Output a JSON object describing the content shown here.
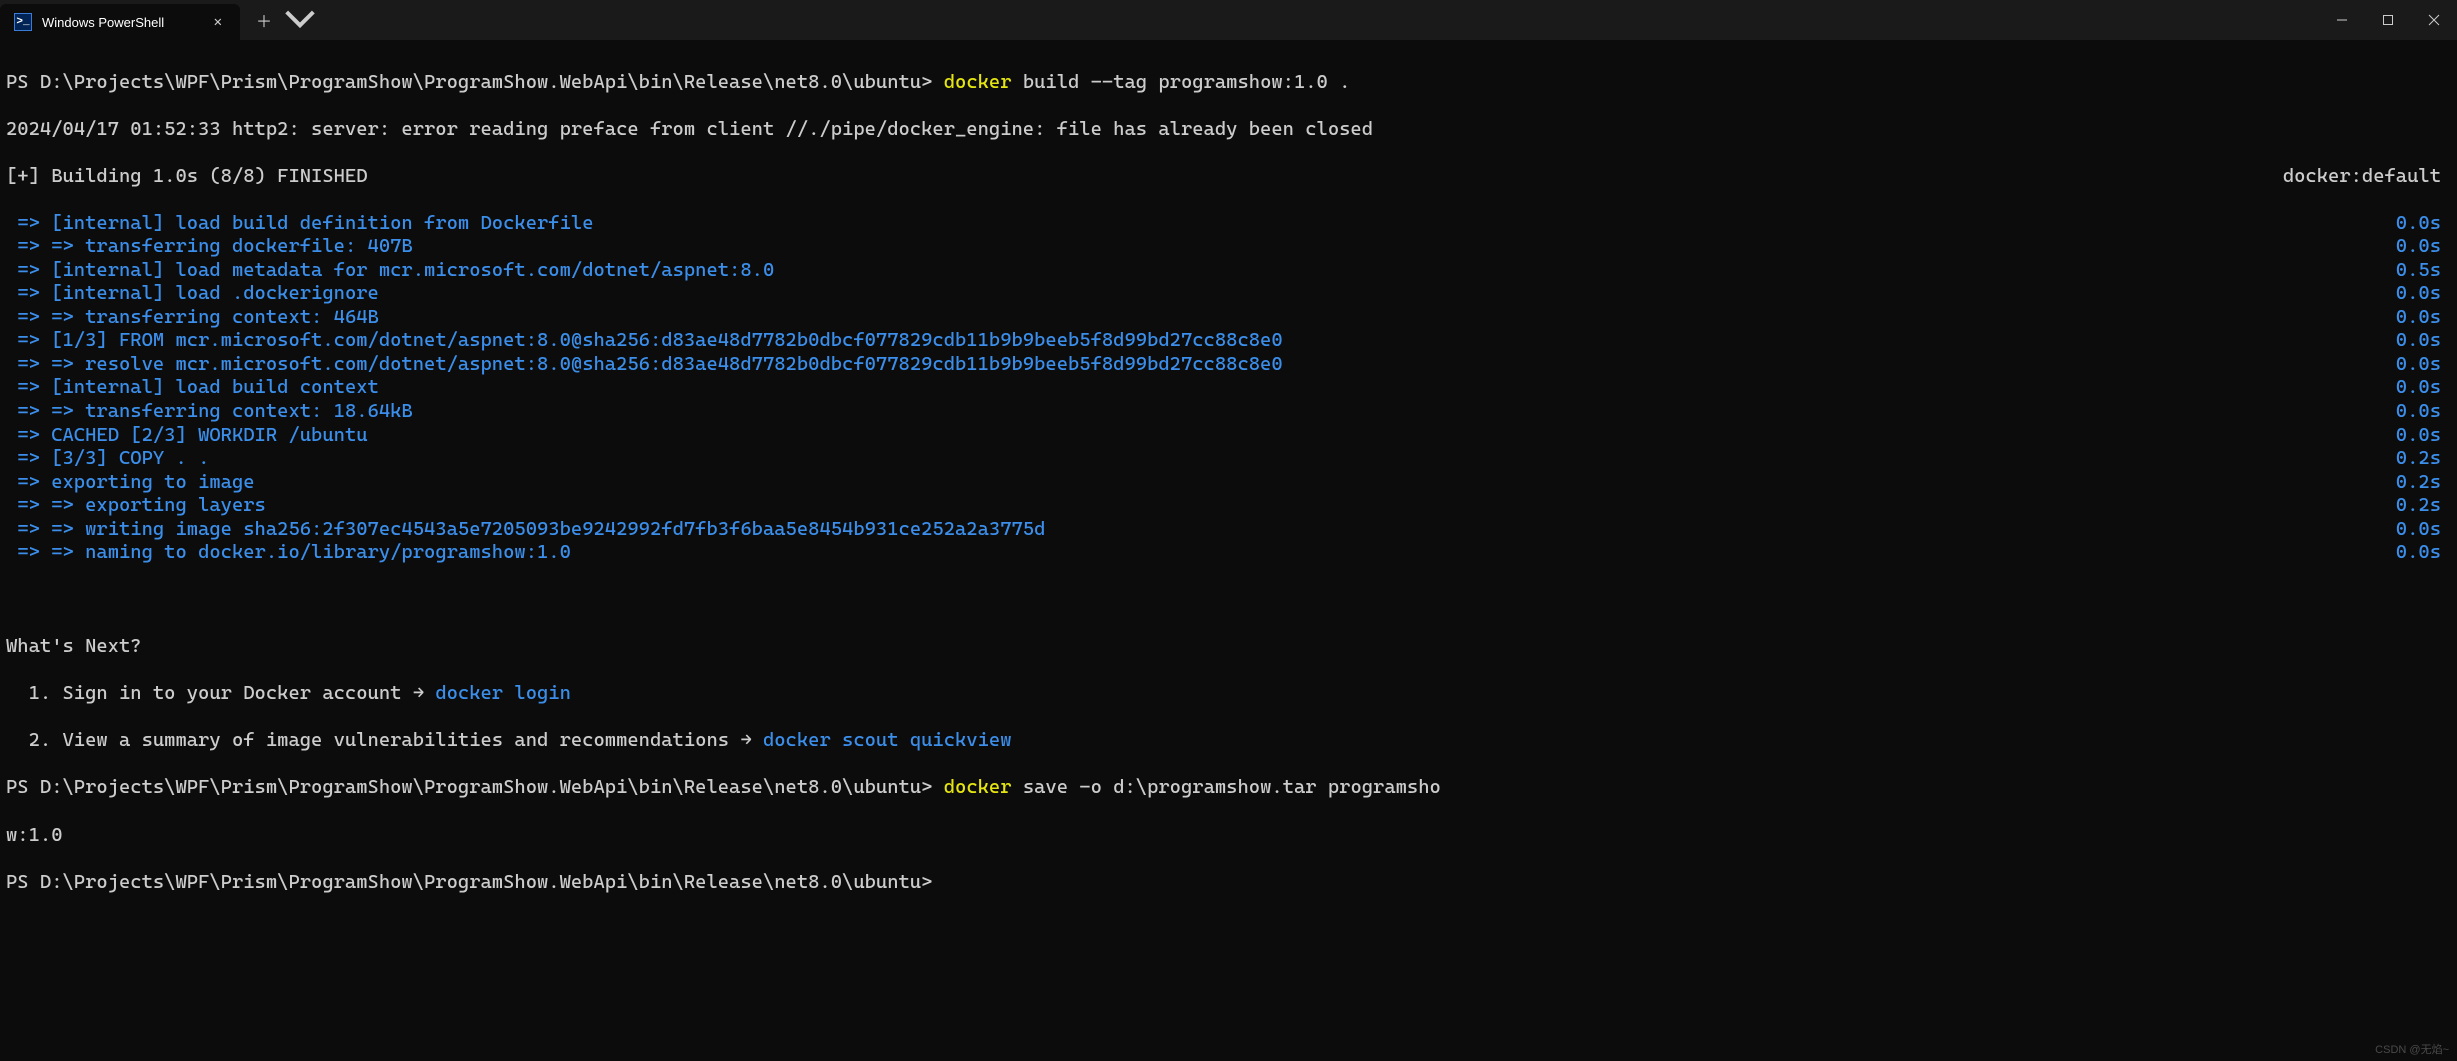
{
  "titlebar": {
    "tab_title": "Windows PowerShell",
    "new_tab_icon": "plus-icon",
    "dropdown_icon": "chevron-down-icon",
    "minimize_icon": "minimize-icon",
    "maximize_icon": "maximize-icon",
    "close_icon": "close-icon"
  },
  "prompt": {
    "path": "PS D:\\Projects\\WPF\\Prism\\ProgramShow\\ProgramShow.WebApi\\bin\\Release\\net8.0\\ubuntu>"
  },
  "cmd1": {
    "exe": "docker",
    "args": " build --tag programshow:1.0 ."
  },
  "err_line": "2024/04/17 01:52:33 http2: server: error reading preface from client //./pipe/docker_engine: file has already been closed",
  "build_header_left": "[+] Building 1.0s (8/8) FINISHED",
  "build_header_right": "docker:default",
  "steps": [
    {
      "left": "=> [internal] load build definition from Dockerfile",
      "right": "0.0s"
    },
    {
      "left": "=> => transferring dockerfile: 407B",
      "right": "0.0s"
    },
    {
      "left": "=> [internal] load metadata for mcr.microsoft.com/dotnet/aspnet:8.0",
      "right": "0.5s"
    },
    {
      "left": "=> [internal] load .dockerignore",
      "right": "0.0s"
    },
    {
      "left": "=> => transferring context: 464B",
      "right": "0.0s"
    },
    {
      "left": "=> [1/3] FROM mcr.microsoft.com/dotnet/aspnet:8.0@sha256:d83ae48d7782b0dbcf077829cdb11b9b9beeb5f8d99bd27cc88c8e0",
      "right": "0.0s"
    },
    {
      "left": "=> => resolve mcr.microsoft.com/dotnet/aspnet:8.0@sha256:d83ae48d7782b0dbcf077829cdb11b9b9beeb5f8d99bd27cc88c8e0",
      "right": "0.0s"
    },
    {
      "left": "=> [internal] load build context",
      "right": "0.0s"
    },
    {
      "left": "=> => transferring context: 18.64kB",
      "right": "0.0s"
    },
    {
      "left": "=> CACHED [2/3] WORKDIR /ubuntu",
      "right": "0.0s"
    },
    {
      "left": "=> [3/3] COPY . .",
      "right": "0.2s"
    },
    {
      "left": "=> exporting to image",
      "right": "0.2s"
    },
    {
      "left": "=> => exporting layers",
      "right": "0.2s"
    },
    {
      "left": "=> => writing image sha256:2f307ec4543a5e7205093be9242992fd7fb3f6baa5e8454b931ce252a2a3775d",
      "right": "0.0s"
    },
    {
      "left": "=> => naming to docker.io/library/programshow:1.0",
      "right": "0.0s"
    }
  ],
  "whats_next": {
    "title": "What's Next?",
    "item1_pre": "  1. Sign in to your Docker account → ",
    "item1_cmd": "docker login",
    "item2_pre": "  2. View a summary of image vulnerabilities and recommendations → ",
    "item2_cmd": "docker scout quickview"
  },
  "cmd2": {
    "exe": "docker",
    "args_line1": " save -o d:\\programshow.tar programsho",
    "args_line2": "w:1.0"
  },
  "watermark": "CSDN @无焰~"
}
